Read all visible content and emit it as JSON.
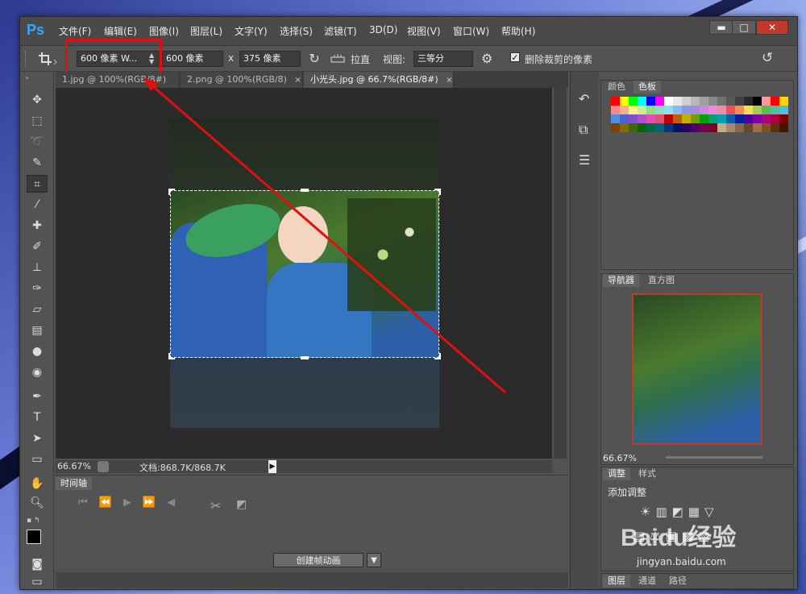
{
  "app": {
    "logo": "Ps"
  },
  "menu": [
    {
      "label": "文件(F)"
    },
    {
      "label": "编辑(E)"
    },
    {
      "label": "图像(I)"
    },
    {
      "label": "图层(L)"
    },
    {
      "label": "文字(Y)"
    },
    {
      "label": "选择(S)"
    },
    {
      "label": "滤镜(T)"
    },
    {
      "label": "3D(D)"
    },
    {
      "label": "视图(V)"
    },
    {
      "label": "窗口(W)"
    },
    {
      "label": "帮助(H)"
    }
  ],
  "window_controls": {
    "minimize": "▬",
    "maximize": "□",
    "close": "✕"
  },
  "options": {
    "preset": "600 像素 W...",
    "width": "600 像素",
    "times": "x",
    "height": "375 像素",
    "straighten": "拉直",
    "view_label": "视图:",
    "view_value": "三等分",
    "delete_cropped": "删除裁剪的像素",
    "delete_cropped_checked": true
  },
  "tabs": [
    {
      "label": "1.jpg @ 100%(RGB/8#)",
      "close": "×"
    },
    {
      "label": "2.png @ 100%(RGB/8)",
      "close": "×"
    },
    {
      "label": "小光头.jpg @ 66.7%(RGB/8#)",
      "close": "×"
    }
  ],
  "status": {
    "zoom": "66.67%",
    "doc": "文档:868.7K/868.7K"
  },
  "timeline": {
    "tab": "时间轴",
    "create_button": "创建帧动画"
  },
  "panels": {
    "color_tab": "颜色",
    "swatches_tab": "色板",
    "navigator_tab": "导航器",
    "histogram_tab": "直方图",
    "navigator_zoom": "66.67%",
    "adjust_tab": "调整",
    "styles_tab": "样式",
    "adjust_title": "添加调整",
    "layers_tab": "图层",
    "channels_tab": "通道",
    "paths_tab": "路径"
  },
  "watermark": {
    "text": "Baidu经验",
    "url": "jingyan.baidu.com"
  },
  "annotation_color": "#e01010"
}
